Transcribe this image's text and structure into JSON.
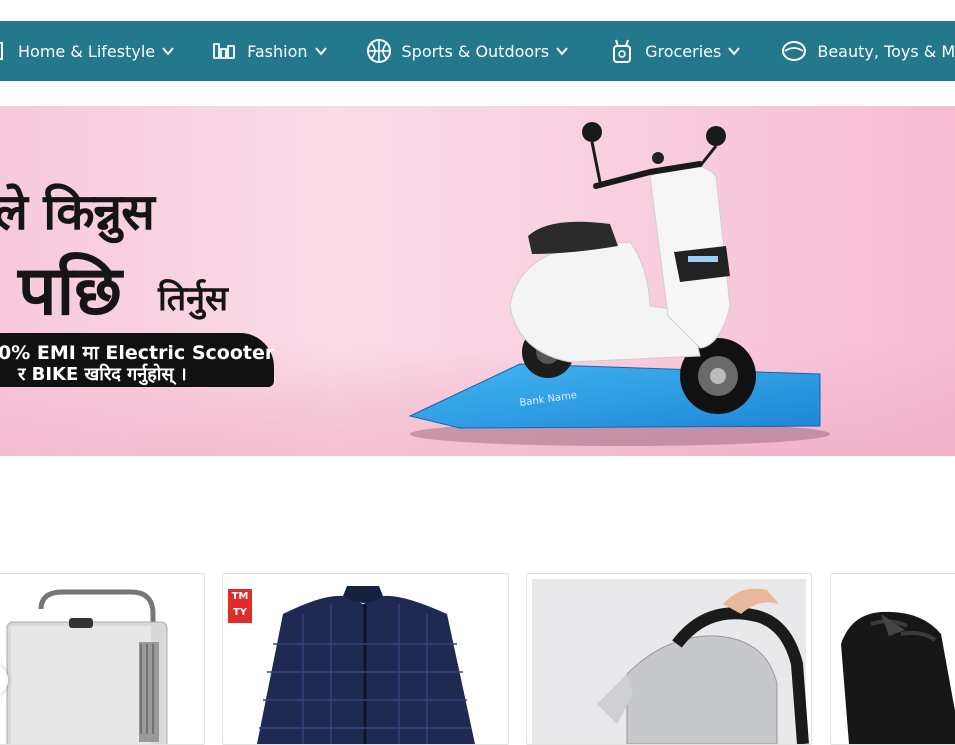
{
  "nav": {
    "categories": [
      {
        "label": "Home & Lifestyle",
        "icon": "home-lifestyle-icon"
      },
      {
        "label": "Fashion",
        "icon": "fashion-icon"
      },
      {
        "label": "Sports & Outdoors",
        "icon": "basketball-icon"
      },
      {
        "label": "Groceries",
        "icon": "groceries-bag-icon"
      },
      {
        "label": "Beauty, Toys & Mo",
        "icon": "beauty-icon"
      }
    ],
    "accent": "#23788c"
  },
  "banner": {
    "line1": "ले किन्नुस",
    "line2": "पछि",
    "line3": "तिर्नुस",
    "emi_line1": "0% EMI मा Electric Scooter",
    "emi_line2": "र BIKE खरिद गर्नुहोस् ।",
    "card_text": "Bank Name"
  },
  "products": {
    "badge_text_1": "TM",
    "badge_text_2": "TY"
  }
}
